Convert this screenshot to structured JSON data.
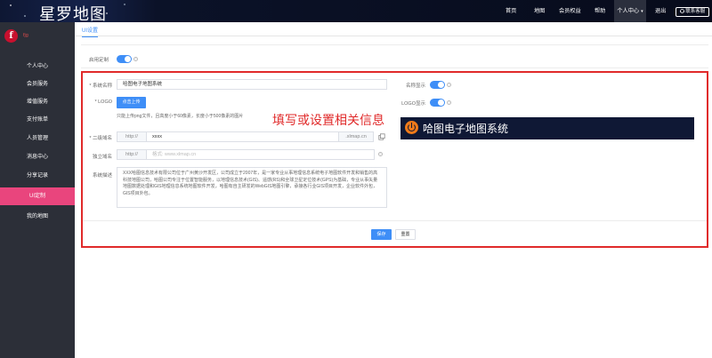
{
  "header": {
    "logo_text": "星罗地图",
    "nav": [
      "首页",
      "地图",
      "会员权益",
      "帮助"
    ],
    "nav_active": "个人中心",
    "nav_caret": "▾",
    "logout": "退出",
    "feedback": "联系客服"
  },
  "sidebar": {
    "avatar_letter": "f",
    "username": "fjg",
    "items": [
      "个人中心",
      "会员服务",
      "增值服务",
      "支付账单",
      "人员管理",
      "消息中心",
      "分享记录",
      "UI定制",
      "我的地图"
    ],
    "active_index": 7
  },
  "main": {
    "tab": "UI设置",
    "enable_custom_label": "启用定制",
    "system_name_label": "* 系统名称",
    "system_name_value": "哈图电子地图系统",
    "show_name_label": "名称显示",
    "logo_label": "* LOGO",
    "upload_button": "点击上传",
    "logo_hint": "只能上传png文件，且高度小于60像素，长度小于500像素的图片",
    "show_logo_label": "LOGO显示",
    "annotation": "填写或设置相关信息",
    "subdomain_label": "* 二级域名",
    "subdomain_prefix": "http://",
    "subdomain_value": "xxxx",
    "subdomain_suffix": ".xlmap.cn",
    "custom_domain_label": "独立域名",
    "custom_domain_prefix": "http://",
    "custom_domain_placeholder": "格式: www.xlmap.cn",
    "desc_label": "系统描述",
    "desc_value": "XXX哈图信息技术有限公司位于广州黄沙开发区，公司成立于2007年，是一家专业从事地理信息系统电子地图软件开发和销售的高科技地图公司，哈图公司专注于位置智能服务，以地理信息技术(GIS)、遥感(RS)和全球卫星定位技术(GPS)为基础，专业从事矢量地图数据处理和GIS地理信息系统地图软件开发，哈图有自主研发的WebGIS地图引擎，承接各行业GIS项目开发，企业软件外包，GIS项目外包。",
    "preview_title": "哈图电子地图系统",
    "save_button": "保存",
    "reset_button": "重置",
    "help_icon_glyph": "?"
  },
  "colors": {
    "accent": "#3e8ef7",
    "sidebar_active": "#e9457d",
    "annotation_red": "#e02a2a",
    "sidebar_bg": "#2c2f38",
    "topbar_bg": "#070b1b"
  }
}
